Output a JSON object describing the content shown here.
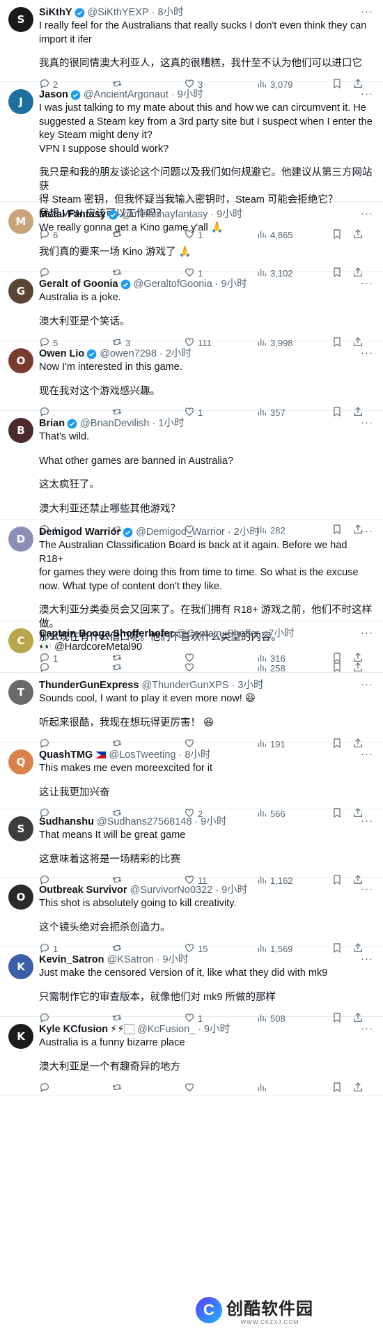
{
  "tweets": [
    {
      "name": "SiKthY",
      "verified": true,
      "handle": "@SiKthYEXP",
      "time": "· 8小时",
      "avatar_color": "#1a1a1a",
      "avatar_initial": "S",
      "lines": [
        "I really feel for the Australians that really sucks I don't even think they can",
        "import it ifer",
        "",
        "我真的很同情澳大利亚人，这真的很糟糕，我什至不认为他们可以进口它"
      ],
      "replies": "2",
      "retweets": "",
      "likes": "3",
      "views": "3,079",
      "height": 118
    },
    {
      "name": "Jason",
      "verified": true,
      "handle": "@AncientArgonaut",
      "time": "· 9小时",
      "avatar_color": "#1f6f9e",
      "avatar_initial": "J",
      "lines": [
        "I was just talking to my mate about this and how we can circumvent it. He",
        "suggested a Steam key from a 3rd party site but I suspect when I enter the",
        "key Steam might deny it?",
        "VPN I suppose should work?",
        "",
        "我只是和我的朋友谈论这个问题以及我们如何规避它。他建议从第三方网站获",
        "得 Steam 密钥，但我怀疑当我输入密钥时，Steam 可能会拒绝它？",
        "我想 VPN 应该可以工作吗？"
      ],
      "replies": "6",
      "retweets": "",
      "likes": "1",
      "views": "4,865",
      "height": 172
    },
    {
      "name": "Metal Fantasy",
      "verified": true,
      "handle": "@metalmayfantasy",
      "time": "· 9小时",
      "avatar_color": "#c9a37a",
      "avatar_initial": "M",
      "lines": [
        "We really gonna get a Kino game y'all 🙏",
        "",
        "我们真的要来一场 Kino 游戏了 🙏"
      ],
      "replies": "",
      "retweets": "",
      "likes": "1",
      "views": "3,102",
      "height": 100
    },
    {
      "name": "Geralt of Goonia",
      "verified": true,
      "handle": "@GeraltofGoonia",
      "time": "· 9小时",
      "avatar_color": "#5b4636",
      "avatar_initial": "G",
      "lines": [
        "Australia is a joke.",
        "",
        "澳大利亚是个笑话。"
      ],
      "replies": "5",
      "retweets": "3",
      "likes": "111",
      "views": "3,998",
      "height": 100
    },
    {
      "name": "Owen Lio",
      "verified": true,
      "handle": "@owen7298",
      "time": "· 2小时",
      "avatar_color": "#7a3b2e",
      "avatar_initial": "O",
      "lines": [
        "Now I'm interested in this game.",
        "",
        "现在我对这个游戏感兴趣。"
      ],
      "replies": "",
      "retweets": "",
      "likes": "1",
      "views": "357",
      "height": 100
    },
    {
      "name": "Brian",
      "verified": true,
      "handle": "@BrianDevilish",
      "time": "· 1小时",
      "avatar_color": "#4a2a2a",
      "avatar_initial": "B",
      "lines": [
        "That's wild.",
        "",
        "What other games are banned in Australia?",
        "",
        "这太疯狂了。",
        "",
        "澳大利亚还禁止哪些其他游戏？"
      ],
      "replies": "1",
      "retweets": "",
      "likes": "",
      "views": "282",
      "height": 156
    },
    {
      "name": "Demigod Warrior",
      "verified": true,
      "handle": "@Demigod_Warrior",
      "time": "· 2小时",
      "avatar_color": "#8a8fb5",
      "avatar_initial": "D",
      "lines": [
        "The Australian Classification Board is back at it again. Before we had R18+",
        "for games they were doing this from time to time. So what is the excuse",
        "now. What type of content don't they like.",
        "",
        "澳大利亚分类委员会又回来了。在我们拥有 R18+ 游戏之前，他们不时这样做。",
        "那么现在有什么借口呢。他们不喜欢什么类型的内容。"
      ],
      "replies": "1",
      "retweets": "",
      "likes": "",
      "views": "316",
      "height": 146
    },
    {
      "name": "Captain Booga Shofferhofer",
      "verified": false,
      "handle": "@Captain_Shoffer",
      "time": "· 7小时",
      "avatar_color": "#b7a74a",
      "avatar_initial": "C",
      "lines": [
        "👀 @HardcoreMetal90"
      ],
      "replies": "",
      "retweets": "",
      "likes": "",
      "views": "258",
      "height": 74
    },
    {
      "name": "ThunderGunExpress",
      "verified": false,
      "handle": "@ThunderGunXPS",
      "time": "· 3小时",
      "avatar_color": "#6a6a6a",
      "avatar_initial": "T",
      "lines": [
        "Sounds cool, I want to play it even more now! 😆",
        "",
        "听起来很酷，我现在想玩得更厉害！ 😆"
      ],
      "replies": "",
      "retweets": "",
      "likes": "",
      "views": "191",
      "height": 100
    },
    {
      "name": "QuashTMG",
      "verified": false,
      "flag": true,
      "handle": "@LosTweeting",
      "time": "· 8小时",
      "avatar_color": "#d9834a",
      "avatar_initial": "Q",
      "lines": [
        "This makes me even moreexcited for it",
        "",
        "这让我更加兴奋"
      ],
      "replies": "",
      "retweets": "",
      "likes": "2",
      "views": "566",
      "height": 96
    },
    {
      "name": "Sudhanshu",
      "verified": false,
      "handle": "@Sudhans27568148",
      "time": "· 9小时",
      "avatar_color": "#3d3d3d",
      "avatar_initial": "S",
      "lines": [
        "That means It will be great game",
        "",
        "这意味着这将是一场精彩的比赛"
      ],
      "replies": "",
      "retweets": "",
      "likes": "11",
      "views": "1,162",
      "height": 98
    },
    {
      "name": "Outbreak Survivor",
      "verified": false,
      "handle": "@SurvivorNo0322",
      "time": "· 9小时",
      "avatar_color": "#2a2a2a",
      "avatar_initial": "O",
      "lines": [
        "This shot is absolutely going to kill creativity.",
        "",
        "这个镜头绝对会扼杀创造力。"
      ],
      "replies": "1",
      "retweets": "",
      "likes": "15",
      "views": "1,569",
      "height": 100
    },
    {
      "name": "Kevin_Satron",
      "verified": false,
      "handle": "@KSatron",
      "time": "· 9小时",
      "avatar_color": "#3b5ea8",
      "avatar_initial": "K",
      "lines": [
        "Just make the censored Version of it, like what they did with mk9",
        "",
        "只需制作它的审查版本，就像他们对 mk9 所做的那样"
      ],
      "replies": "",
      "retweets": "",
      "likes": "1",
      "views": "508",
      "height": 100
    },
    {
      "name": "Kyle KCfusion",
      "verified": false,
      "emoji": "⚡⚡🏻",
      "handle": "@KcFusion_",
      "time": "· 9小时",
      "avatar_color": "#1c1c1c",
      "avatar_initial": "K",
      "lines": [
        "Australia is a funny bizarre place",
        "",
        "澳大利亚是一个有趣奇异的地方"
      ],
      "replies": "",
      "retweets": "",
      "likes": "",
      "views": "",
      "height": 114
    }
  ],
  "watermark": {
    "brand": "创酷软件园",
    "url": "WWW.CKZXJ.COM",
    "logo": "C"
  }
}
